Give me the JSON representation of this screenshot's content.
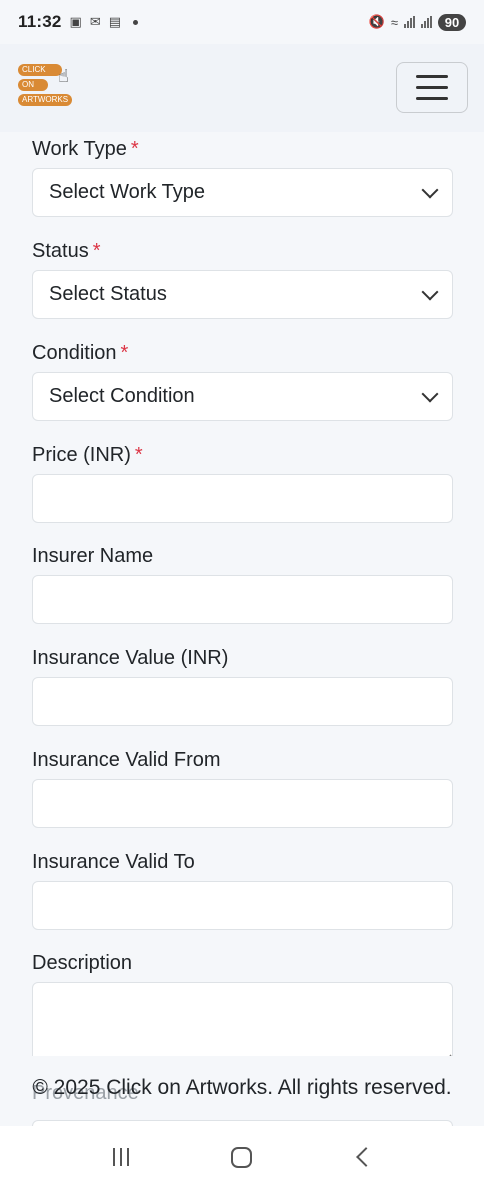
{
  "status_bar": {
    "time": "11:32",
    "battery": "90",
    "icons_left": [
      "screenshot-icon",
      "gmail-icon",
      "outlook-icon",
      "dot-icon"
    ],
    "icons_right": [
      "mute-icon",
      "wifi-icon",
      "signal-icon",
      "signal-icon"
    ]
  },
  "header": {
    "logo": {
      "line1": "CLICK",
      "line2": "ON",
      "line3": "ARTWORKS",
      "color": "#d98a35"
    },
    "menu_icon": "hamburger-menu-icon"
  },
  "form": {
    "fields": [
      {
        "label": "Work Type",
        "required": "*",
        "type": "select",
        "value": "Select Work Type"
      },
      {
        "label": "Status",
        "required": "*",
        "type": "select",
        "value": "Select Status"
      },
      {
        "label": "Condition",
        "required": "*",
        "type": "select",
        "value": "Select Condition"
      },
      {
        "label": "Price (INR)",
        "required": "*",
        "type": "input",
        "value": ""
      },
      {
        "label": "Insurer Name",
        "type": "input",
        "value": ""
      },
      {
        "label": "Insurance Value (INR)",
        "type": "input",
        "value": ""
      },
      {
        "label": "Insurance Valid From",
        "type": "input",
        "value": ""
      },
      {
        "label": "Insurance Valid To",
        "type": "input",
        "value": ""
      },
      {
        "label": "Description",
        "type": "textarea",
        "value": ""
      }
    ],
    "next_field_label": "Provenance"
  },
  "footer": {
    "copyright": "© 2025 Click on Artworks. All rights reserved."
  },
  "colors": {
    "required": "#dc3545",
    "background": "#f5f7fa",
    "logo": "#d98a35"
  }
}
